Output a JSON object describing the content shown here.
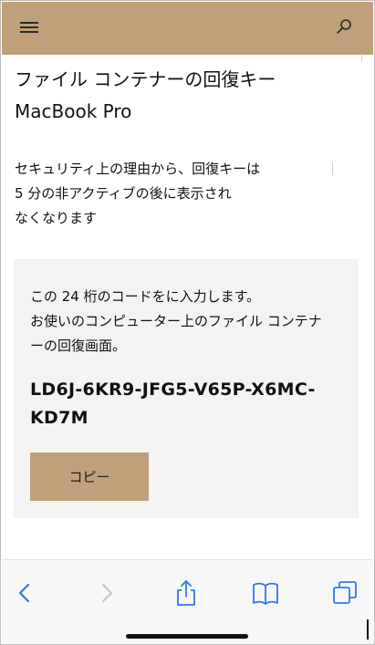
{
  "header": {
    "menu_icon": "hamburger-menu-icon",
    "search_icon": "search-icon",
    "background_color": "#c0a07a"
  },
  "page": {
    "title": "ファイル コンテナーの回復キー",
    "subtitle": "MacBook Pro",
    "security_message_lines": [
      "セキュリティ上の理由から、回復キーは",
      "5 分の非アクティブの後に表示され",
      "なくなります"
    ]
  },
  "card": {
    "instruction_lines": [
      "この 24 桁のコードをに入力します。",
      "お使いのコンピューター上のファイル コンテナ",
      "ーの回復画面。"
    ],
    "recovery_code_lines": [
      "LD6J-6KR9-JFG5-V65P-X6MC-",
      "KD7M"
    ],
    "copy_button_label": "コピー",
    "background_color": "#f3f3f3"
  },
  "toolbar": {
    "accent_color": "#2f7ae5",
    "disabled_color": "#c8c8c8",
    "icons": [
      "back-icon",
      "forward-icon",
      "share-icon",
      "bookmarks-icon",
      "tabs-icon"
    ]
  }
}
